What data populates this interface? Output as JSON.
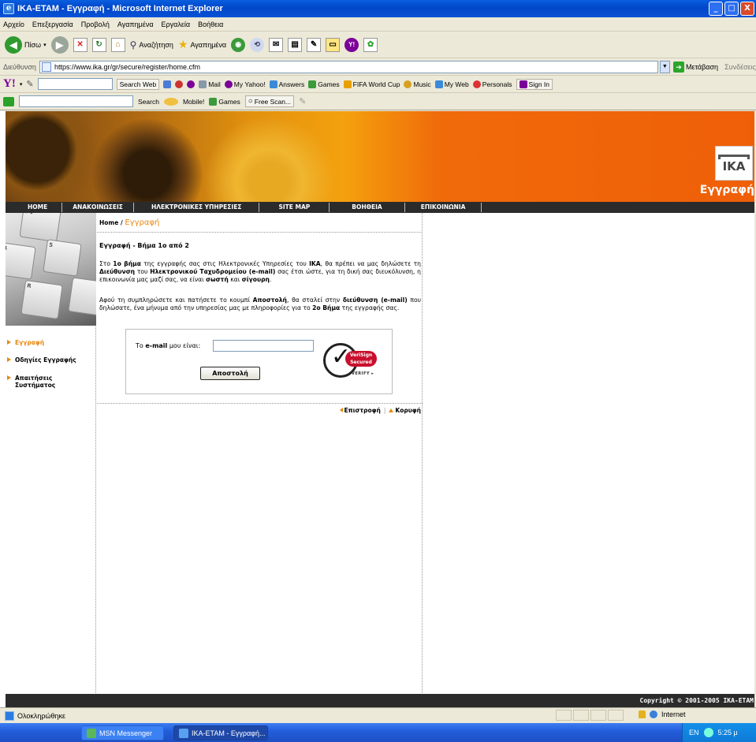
{
  "window": {
    "title": "IKA-ETAM - Εγγραφή - Microsoft Internet Explorer",
    "min_label": "_",
    "max_label": "□",
    "close_label": "X"
  },
  "menu": [
    "Αρχείο",
    "Επεξεργασία",
    "Προβολή",
    "Αγαπημένα",
    "Εργαλεία",
    "Βοήθεια"
  ],
  "toolbar": {
    "back_label": "Πίσω",
    "search_label": "Αναζήτηση",
    "favorites_label": "Αγαπημένα"
  },
  "address": {
    "label": "Διεύθυνση",
    "url": "https://www.ika.gr/gr/secure/register/home.cfm",
    "go_label": "Μετάβαση",
    "links_label": "Συνδέσεις"
  },
  "yahoo_toolbar": {
    "search_web": "Search Web",
    "items": [
      "Mail",
      "My Yahoo!",
      "Answers",
      "Games",
      "FIFA World Cup",
      "Music",
      "My Web",
      "Personals",
      "Sign In"
    ]
  },
  "msn_toolbar": {
    "search": "Search",
    "mobile": "Mobile!",
    "games": "Games",
    "free_scan": "Free Scan..."
  },
  "site": {
    "logo_text": "IKA",
    "page_heading": "Εγγραφή",
    "nav": [
      "HOME",
      "ΑΝΑΚΟΙΝΩΣΕΙΣ",
      "ΗΛΕΚΤΡΟΝΙΚΕΣ ΥΠΗΡΕΣΙΕΣ",
      "SITE MAP",
      "ΒΟΗΘΕΙΑ",
      "ΕΠΙΚΟΙΝΩΝΙΑ"
    ],
    "keyboard_keys": [
      "F4",
      "4",
      "5",
      "R"
    ],
    "sidebar": [
      {
        "label": "Εγγραφή",
        "active": true
      },
      {
        "label": "Οδηγίες Εγγραφής",
        "active": false
      },
      {
        "label": "Απαιτήσεις Συστήματος",
        "active": false
      }
    ],
    "breadcrumb": {
      "home": "Home",
      "separator": "/",
      "current": "Εγγραφή"
    },
    "step_title": "Εγγραφή - Βήμα 1ο από 2",
    "para1": {
      "t1": "Στο ",
      "b1": "1ο βήμα",
      "t2": " της εγγραφής σας στις Ηλεκτρονικές Υπηρεσίες του ",
      "b2": "ΙΚΑ",
      "t3": ", θα πρέπει να μας δηλώσετε τη ",
      "b3": "Διεύθυνση",
      "t4": " του ",
      "b4": "Ηλεκτρονικού Ταχυδρομείου (e-mail)",
      "t5": " σας έτσι ώστε, για τη δική σας διευκόλυνση, η επικοινωνία μας μαζί σας, να είναι ",
      "b5": "σωστή",
      "t6": " και ",
      "b6": "σίγουρη",
      "t7": "."
    },
    "para2": {
      "t1": "Αφού τη συμπληρώσετε και πατήσετε το κουμπί ",
      "b1": "Αποστολή",
      "t2": ", θα σταλεί στην ",
      "b2": "διεύθυνση (e-mail)",
      "t3": " που δηλώσατε, ένα μήνυμα από την υπηρεσίας μας με πληροφορίες για το ",
      "b3": "2ο Βήμα",
      "t4": " της εγγραφής σας."
    },
    "form": {
      "label_pre": "Το ",
      "label_bold": "e-mail",
      "label_post": " μου είναι:",
      "email_value": "",
      "submit_label": "Αποστολή"
    },
    "verisign": {
      "line1": "VeriSign",
      "line2": "Secured",
      "verify": "VERIFY ▸"
    },
    "footer_links": {
      "back": "Επιστροφή",
      "top": "Κορυφή",
      "separator": "|"
    },
    "copyright": "Copyright © 2001-2005 IKA-ETAM"
  },
  "statusbar": {
    "text": "Ολοκληρώθηκε",
    "zone": "Internet"
  },
  "taskbar": {
    "buttons": [
      "MSN Messenger",
      "IKA-ETAM - Εγγραφή..."
    ],
    "lang": "EN",
    "clock": "5:25 μ"
  },
  "colors": {
    "accent_orange": "#e8870e",
    "nav_bg": "#2b2b2b",
    "banner_orange": "#ef5f08"
  }
}
